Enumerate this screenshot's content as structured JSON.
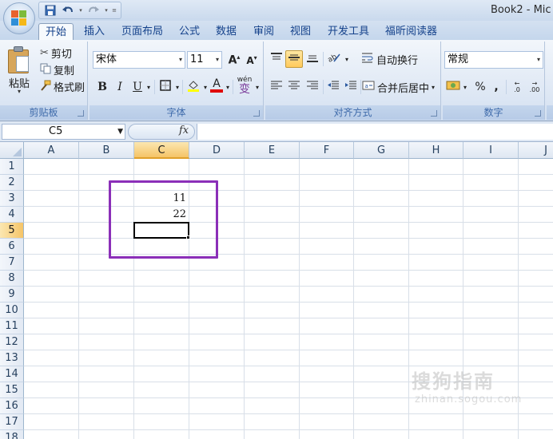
{
  "window": {
    "title": "Book2 - Mic"
  },
  "quick_access": {
    "save_icon": "save-icon",
    "undo_icon": "undo-icon",
    "redo_icon": "redo-icon"
  },
  "tabs": [
    {
      "label": "开始",
      "active": true
    },
    {
      "label": "插入"
    },
    {
      "label": "页面布局"
    },
    {
      "label": "公式"
    },
    {
      "label": "数据"
    },
    {
      "label": "审阅"
    },
    {
      "label": "视图"
    },
    {
      "label": "开发工具"
    },
    {
      "label": "福昕阅读器"
    }
  ],
  "ribbon": {
    "clipboard": {
      "label": "剪贴板",
      "paste": "粘贴",
      "cut": "剪切",
      "copy": "复制",
      "format_painter": "格式刷"
    },
    "font": {
      "label": "字体",
      "font_name": "宋体",
      "font_size": "11",
      "bold": "B",
      "italic": "I",
      "underline": "U",
      "font_color": "A",
      "phonetic": "wén"
    },
    "alignment": {
      "label": "对齐方式",
      "wrap_text": "自动换行",
      "merge_center": "合并后居中"
    },
    "number": {
      "label": "数字",
      "format": "常规",
      "percent": "%",
      "comma": ",",
      "inc_decimal": ".0",
      "dec_decimal": ".00"
    }
  },
  "formula_bar": {
    "name_box": "C5",
    "fx": "fx",
    "formula": ""
  },
  "sheet": {
    "columns": [
      "A",
      "B",
      "C",
      "D",
      "E",
      "F",
      "G",
      "H",
      "I",
      "J"
    ],
    "rows": [
      "1",
      "2",
      "3",
      "4",
      "5",
      "6",
      "7",
      "8",
      "9",
      "10",
      "11",
      "12",
      "13",
      "14",
      "15",
      "16",
      "17",
      "18"
    ],
    "selected_column": "C",
    "selected_row": "5",
    "cells": {
      "C3": "11",
      "C4": "22",
      "C5": ""
    }
  },
  "watermark": {
    "logo": "搜狗指南",
    "url": "zhinan.sogou.com"
  },
  "colors": {
    "highlight_box": "#8b2fb8",
    "selection_header": "#f5c467",
    "ribbon_text": "#15428b"
  }
}
